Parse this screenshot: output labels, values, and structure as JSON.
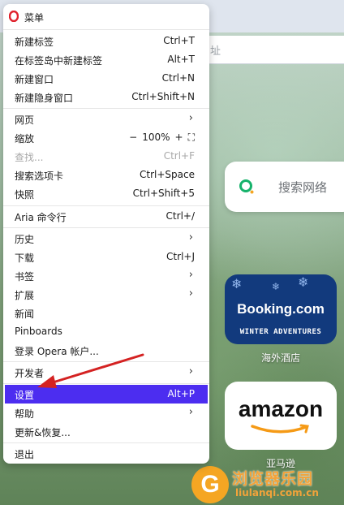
{
  "background": {
    "address_tail": "址",
    "search_label": "搜索网络",
    "tiles": [
      {
        "title": "Booking.com",
        "subtitle": "WINTER ADVENTURES",
        "caption": "海外酒店"
      },
      {
        "title": "amazon",
        "caption": "亚马逊"
      }
    ],
    "watermark": {
      "title": "浏览器乐园",
      "url": "liulanqi.com.cn"
    }
  },
  "menu": {
    "title": "菜单",
    "items": [
      {
        "label": "新建标签",
        "shortcut": "Ctrl+T"
      },
      {
        "label": "在标签岛中新建标签",
        "shortcut": "Alt+T"
      },
      {
        "label": "新建窗口",
        "shortcut": "Ctrl+N"
      },
      {
        "label": "新建隐身窗口",
        "shortcut": "Ctrl+Shift+N"
      },
      {
        "label": "网页",
        "shortcut": ""
      },
      {
        "label": "缩放",
        "shortcut": ""
      },
      {
        "label": "查找...",
        "shortcut": "Ctrl+F"
      },
      {
        "label": "搜索选项卡",
        "shortcut": "Ctrl+Space"
      },
      {
        "label": "快照",
        "shortcut": "Ctrl+Shift+5"
      },
      {
        "label": "Aria 命令行",
        "shortcut": "Ctrl+/"
      },
      {
        "label": "历史",
        "shortcut": ""
      },
      {
        "label": "下载",
        "shortcut": "Ctrl+J"
      },
      {
        "label": "书签",
        "shortcut": ""
      },
      {
        "label": "扩展",
        "shortcut": ""
      },
      {
        "label": "新闻",
        "shortcut": ""
      },
      {
        "label": "Pinboards",
        "shortcut": ""
      },
      {
        "label": "登录 Opera 帐户...",
        "shortcut": ""
      },
      {
        "label": "开发者",
        "shortcut": ""
      },
      {
        "label": "设置",
        "shortcut": "Alt+P"
      },
      {
        "label": "帮助",
        "shortcut": ""
      },
      {
        "label": "更新&恢复...",
        "shortcut": ""
      },
      {
        "label": "退出",
        "shortcut": ""
      }
    ],
    "zoom": {
      "minus": "−",
      "value": "100%",
      "plus": "+",
      "fullscreen": "⛶"
    },
    "submenu_chevron": "›"
  },
  "colors": {
    "highlight": "#4c2df0",
    "opera_red": "#e0212c",
    "arrow": "#d42222"
  }
}
